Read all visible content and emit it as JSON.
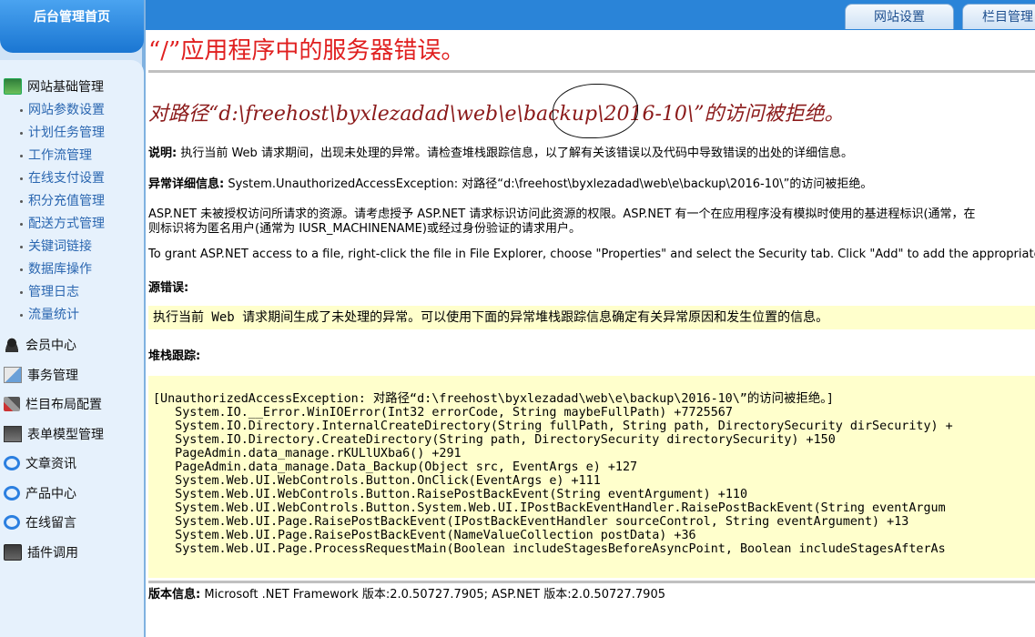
{
  "sidebar": {
    "home": "后台管理首页",
    "groups": [
      {
        "label": "网站基础管理",
        "icon": "network-icon"
      },
      {
        "label": "会员中心",
        "icon": "user-icon"
      },
      {
        "label": "事务管理",
        "icon": "task-icon"
      },
      {
        "label": "栏目布局配置",
        "icon": "tools-icon"
      },
      {
        "label": "表单模型管理",
        "icon": "form-icon"
      },
      {
        "label": "文章资讯",
        "icon": "ie-icon"
      },
      {
        "label": "产品中心",
        "icon": "ie-icon"
      },
      {
        "label": "在线留言",
        "icon": "ie-icon"
      },
      {
        "label": "插件调用",
        "icon": "plugin-icon"
      }
    ],
    "sub_items": [
      "网站参数设置",
      "计划任务管理",
      "工作流管理",
      "在线支付设置",
      "积分充值管理",
      "配送方式管理",
      "关键词链接",
      "数据库操作",
      "管理日志",
      "流量统计"
    ]
  },
  "top_tabs": {
    "site_settings": "网站设置",
    "column_manage": "栏目管理"
  },
  "error": {
    "title": "“/”应用程序中的服务器错误。",
    "message": "对路径“d:\\freehost\\byxlezadad\\web\\e\\backup\\2016-10\\”的访问被拒绝。",
    "desc_label": "说明:",
    "desc_text": " 执行当前 Web 请求期间，出现未处理的异常。请检查堆栈跟踪信息，以了解有关该错误以及代码中导致错误的出处的详细信息。",
    "detail_label": "异常详细信息:",
    "detail_text": " System.UnauthorizedAccessException: 对路径“d:\\freehost\\byxlezadad\\web\\e\\backup\\2016-10\\”的访问被拒绝。",
    "aspnet_line1": "ASP.NET 未被授权访问所请求的资源。请考虑授予 ASP.NET 请求标识访问此资源的权限。ASP.NET 有一个在应用程序没有模拟时使用的基进程标识(通常，在",
    "aspnet_line2": "则标识将为匿名用户(通常为 IUSR_MACHINENAME)或经过身份验证的请求用户。",
    "grant_text": "To grant ASP.NET access to a file, right-click the file in File Explorer, choose \"Properties\" and select the Security tab. Click \"Add\" to add the appropriate user",
    "source_label": "源错误:",
    "source_text": "执行当前 Web 请求期间生成了未处理的异常。可以使用下面的异常堆栈跟踪信息确定有关异常原因和发生位置的信息。",
    "stack_label": "堆栈跟踪:",
    "stack_lines": [
      "[UnauthorizedAccessException: 对路径“d:\\freehost\\byxlezadad\\web\\e\\backup\\2016-10\\”的访问被拒绝。]",
      "   System.IO.__Error.WinIOError(Int32 errorCode, String maybeFullPath) +7725567",
      "   System.IO.Directory.InternalCreateDirectory(String fullPath, String path, DirectorySecurity dirSecurity) +",
      "   System.IO.Directory.CreateDirectory(String path, DirectorySecurity directorySecurity) +150",
      "   PageAdmin.data_manage.rKULlUXba6() +291",
      "   PageAdmin.data_manage.Data_Backup(Object src, EventArgs e) +127",
      "   System.Web.UI.WebControls.Button.OnClick(EventArgs e) +111",
      "   System.Web.UI.WebControls.Button.RaisePostBackEvent(String eventArgument) +110",
      "   System.Web.UI.WebControls.Button.System.Web.UI.IPostBackEventHandler.RaisePostBackEvent(String eventArgum",
      "   System.Web.UI.Page.RaisePostBackEvent(IPostBackEventHandler sourceControl, String eventArgument) +13",
      "   System.Web.UI.Page.RaisePostBackEvent(NameValueCollection postData) +36",
      "   System.Web.UI.Page.ProcessRequestMain(Boolean includeStagesBeforeAsyncPoint, Boolean includeStagesAfterAs"
    ],
    "version_label": "版本信息:",
    "version_text": " Microsoft .NET Framework 版本:2.0.50727.7905; ASP.NET 版本:2.0.50727.7905"
  }
}
